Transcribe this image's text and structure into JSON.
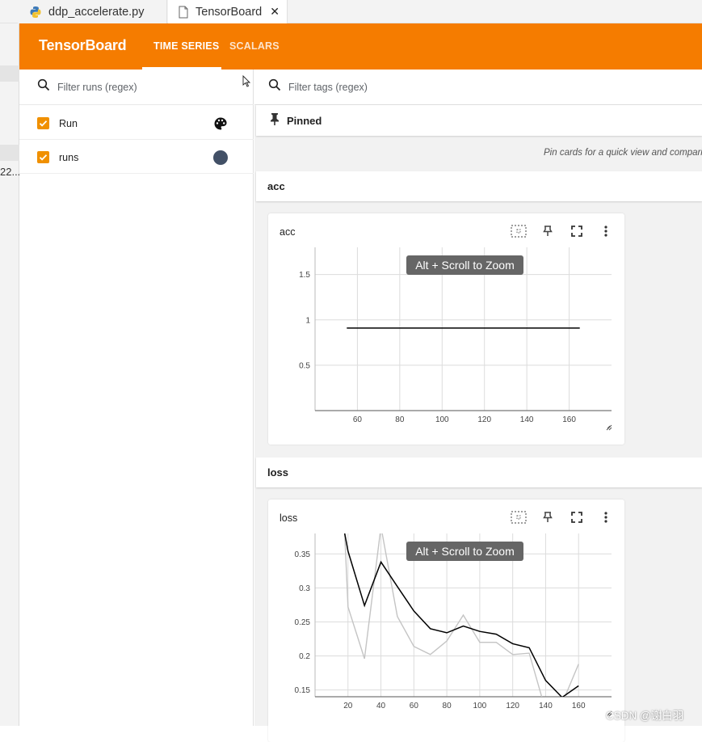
{
  "editor_tabs": [
    {
      "label": "ddp_accelerate.py",
      "icon": "python-icon"
    },
    {
      "label": "TensorBoard",
      "icon": "file-icon",
      "close": "✕"
    }
  ],
  "gutter_text": "22...",
  "header": {
    "brand": "TensorBoard",
    "tabs": [
      "TIME SERIES",
      "SCALARS"
    ],
    "active_tab": "TIME SERIES",
    "color": "#f57c00"
  },
  "sidebar": {
    "filter_placeholder": "Filter runs (regex)",
    "runs": [
      {
        "label": "Run",
        "checked": true,
        "color_icon": "palette-icon"
      },
      {
        "label": "runs",
        "checked": true,
        "color": "#425066"
      }
    ]
  },
  "main": {
    "tag_filter_placeholder": "Filter tags (regex)",
    "pinned_label": "Pinned",
    "pinned_hint": "Pin cards for a quick view and compari",
    "groups": [
      {
        "name": "acc"
      },
      {
        "name": "loss"
      }
    ]
  },
  "cards": [
    {
      "title": "acc",
      "zoom_hint": "Alt + Scroll to Zoom"
    },
    {
      "title": "loss",
      "zoom_hint": "Alt + Scroll to Zoom"
    }
  ],
  "chart_data": [
    {
      "type": "line",
      "title": "acc",
      "x_ticks": [
        60,
        80,
        100,
        120,
        140,
        160
      ],
      "y_ticks": [
        0.5,
        1,
        1.5
      ],
      "y_tick_labels": [
        "0.5",
        "1",
        "1.5"
      ],
      "xlim": [
        40,
        180
      ],
      "ylim": [
        0.0,
        1.8
      ],
      "series": [
        {
          "x": [
            55,
            165
          ],
          "y": [
            0.91,
            0.91
          ],
          "color": "#000000"
        }
      ]
    },
    {
      "type": "line",
      "title": "loss",
      "x_ticks": [
        20,
        40,
        60,
        80,
        100,
        120,
        140,
        160
      ],
      "y_ticks": [
        0.15,
        0.2,
        0.25,
        0.3,
        0.35
      ],
      "y_tick_labels": [
        "0.15",
        "0.2",
        "0.25",
        "0.3",
        "0.35"
      ],
      "xlim": [
        0,
        180
      ],
      "ylim": [
        0.14,
        0.38
      ],
      "series": [
        {
          "x": [
            18,
            20,
            30,
            40,
            50,
            60,
            70,
            80,
            90,
            100,
            110,
            120,
            130,
            140,
            150,
            160
          ],
          "y": [
            0.38,
            0.354,
            0.274,
            0.338,
            0.302,
            0.266,
            0.24,
            0.234,
            0.244,
            0.236,
            0.232,
            0.218,
            0.212,
            0.164,
            0.139,
            0.156
          ],
          "color": "#000000"
        },
        {
          "x": [
            18,
            20,
            30,
            40,
            50,
            60,
            70,
            80,
            90,
            100,
            110,
            120,
            130,
            140,
            150,
            160
          ],
          "y": [
            0.38,
            0.272,
            0.196,
            0.39,
            0.258,
            0.214,
            0.202,
            0.222,
            0.26,
            0.22,
            0.22,
            0.202,
            0.204,
            0.12,
            0.13,
            0.188
          ],
          "color": "#c4c4c4"
        }
      ]
    }
  ],
  "watermark": "CSDN @谢白羽"
}
